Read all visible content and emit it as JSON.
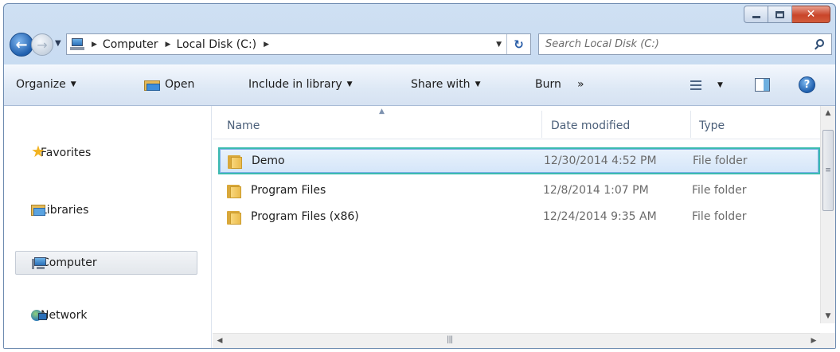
{
  "window": {
    "caption": {
      "minimize": "",
      "maximize": "",
      "close": "✕"
    }
  },
  "address": {
    "crumbs": [
      "Computer",
      "Local Disk (C:)"
    ]
  },
  "search": {
    "placeholder": "Search Local Disk (C:)"
  },
  "toolbar": {
    "organize": "Organize",
    "open": "Open",
    "include_in_library": "Include in library",
    "share_with": "Share with",
    "burn": "Burn",
    "more": "»"
  },
  "nav": {
    "items": [
      {
        "label": "Favorites",
        "icon": "star-icon"
      },
      {
        "label": "Libraries",
        "icon": "libraries-icon"
      },
      {
        "label": "Computer",
        "icon": "computer-icon",
        "selected": true
      },
      {
        "label": "Network",
        "icon": "network-icon"
      }
    ]
  },
  "files": {
    "columns": {
      "name": "Name",
      "date": "Date modified",
      "type": "Type"
    },
    "rows": [
      {
        "name": "Demo",
        "date": "12/30/2014 4:52 PM",
        "type": "File folder",
        "selected": true
      },
      {
        "name": "Program Files",
        "date": "12/8/2014 1:07 PM",
        "type": "File folder"
      },
      {
        "name": "Program Files (x86)",
        "date": "12/24/2014 9:35 AM",
        "type": "File folder"
      }
    ]
  },
  "colors": {
    "selection_border": "#3cbab0",
    "selection_fill": "#d5e6f9",
    "chrome": "#bcd3ee"
  }
}
